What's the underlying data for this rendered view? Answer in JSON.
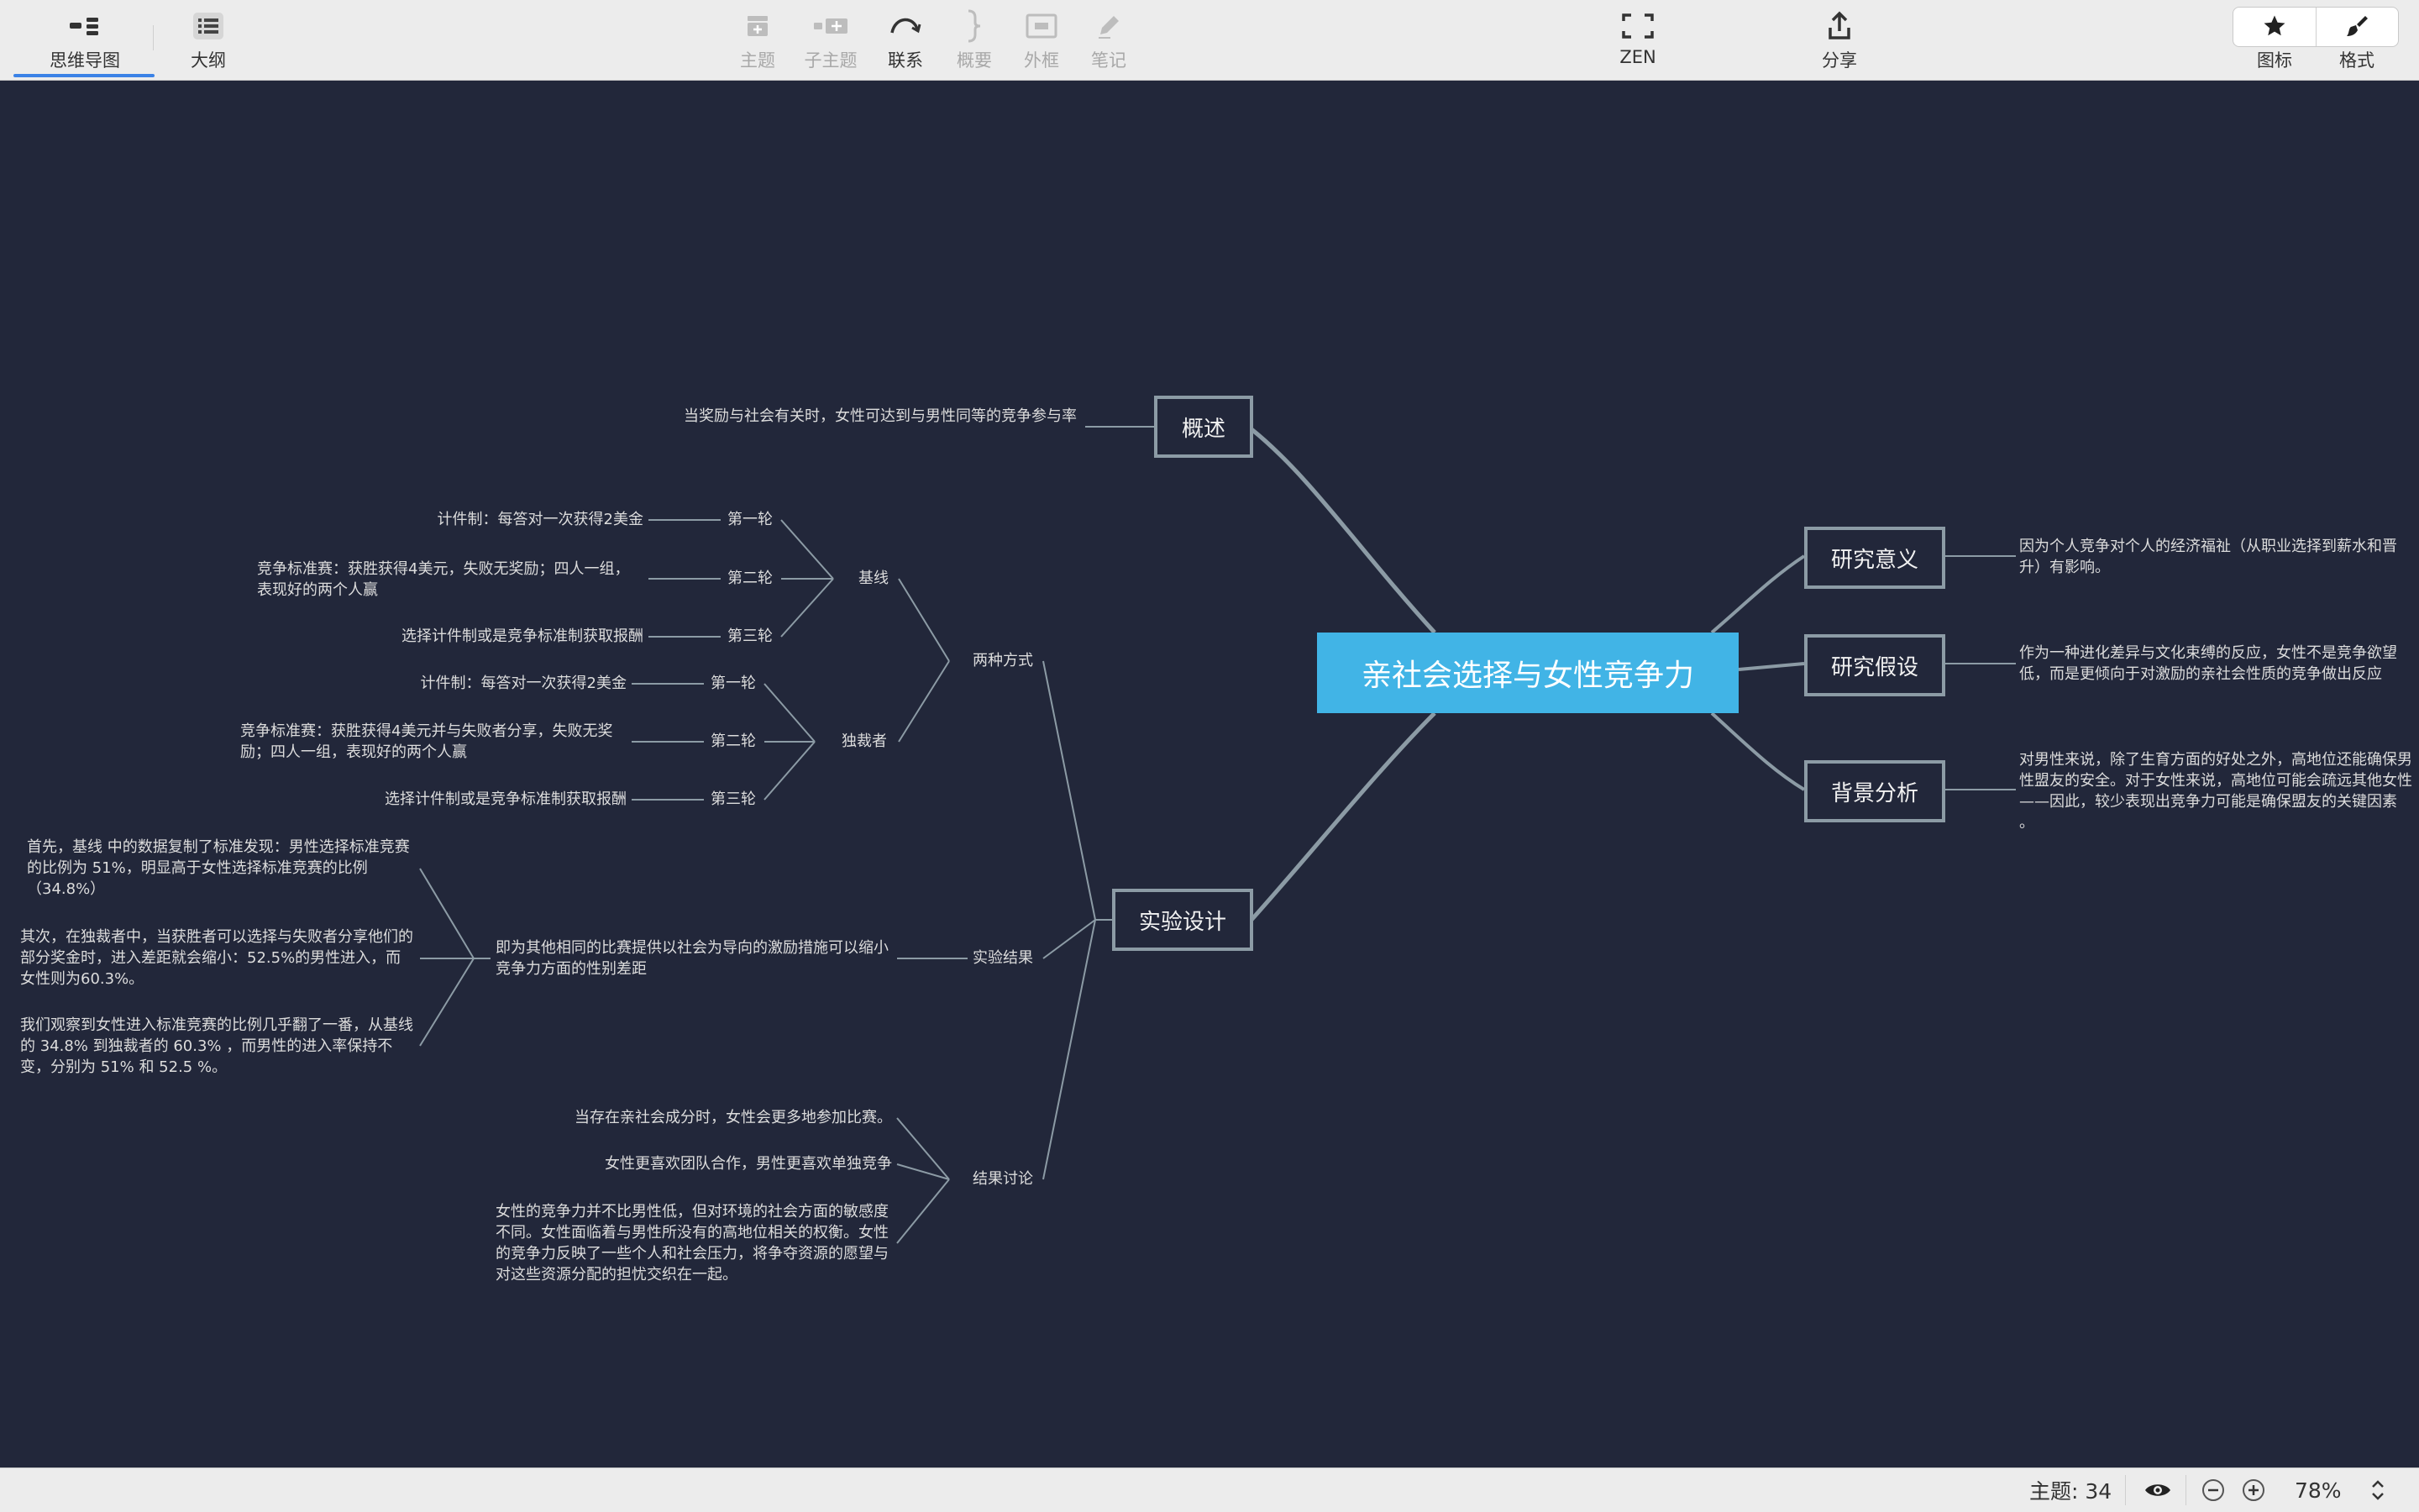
{
  "toolbar": {
    "mindmap_label": "思维导图",
    "outline_label": "大纲",
    "topic_label": "主题",
    "subtopic_label": "子主题",
    "relationship_label": "联系",
    "summary_label": "概要",
    "boundary_label": "外框",
    "notes_label": "笔记",
    "zen_label": "ZEN",
    "share_label": "分享",
    "icon_label": "图标",
    "format_label": "格式"
  },
  "map": {
    "central": "亲社会选择与女性竞争力",
    "overview": {
      "title": "概述",
      "text": "当奖励与社会有关时，女性可达到与男性同等的竞争参与率"
    },
    "significance": {
      "title": "研究意义",
      "text": "因为个人竞争对个人的经济福祉（从职业选择到薪水和晋升）有影响。"
    },
    "hypothesis": {
      "title": "研究假设",
      "text": "作为一种进化差异与文化束缚的反应，女性不是竞争欲望低，而是更倾向于对激励的亲社会性质的竞争做出反应"
    },
    "background": {
      "title": "背景分析",
      "text": "对男性来说，除了生育方面的好处之外，高地位还能确保男性盟友的安全。对于女性来说，高地位可能会疏远其他女性——因此，较少表现出竞争力可能是确保盟友的关键因素 。"
    },
    "design": {
      "title": "实验设计",
      "two_ways": {
        "label": "两种方式",
        "baseline": {
          "label": "基线",
          "rounds": [
            {
              "label": "第一轮",
              "text": "计件制：每答对一次获得2美金"
            },
            {
              "label": "第二轮",
              "text": "竞争标准赛：获胜获得4美元，失败无奖励；四人一组，表现好的两个人赢"
            },
            {
              "label": "第三轮",
              "text": "选择计件制或是竞争标准制获取报酬"
            }
          ]
        },
        "dictator": {
          "label": "独裁者",
          "rounds": [
            {
              "label": "第一轮",
              "text": "计件制：每答对一次获得2美金"
            },
            {
              "label": "第二轮",
              "text": "竞争标准赛：获胜获得4美元并与失败者分享，失败无奖励；四人一组，表现好的两个人赢"
            },
            {
              "label": "第三轮",
              "text": "选择计件制或是竞争标准制获取报酬"
            }
          ]
        }
      },
      "results": {
        "label": "实验结果",
        "summary": "即为其他相同的比赛提供以社会为导向的激励措施可以缩小竞争力方面的性别差距",
        "points": [
          "首先，基线 中的数据复制了标准发现：男性选择标准竞赛的比例为 51%，明显高于女性选择标准竞赛的比例（34.8%）",
          "其次，在独裁者中，当获胜者可以选择与失败者分享他们的部分奖金时，进入差距就会缩小：52.5%的男性进入，而女性则为60.3%。",
          "我们观察到女性进入标准竞赛的比例几乎翻了一番，从基线的 34.8% 到独裁者的 60.3% ，而男性的进入率保持不变，分别为 51% 和 52.5 %。"
        ]
      },
      "discussion": {
        "label": "结果讨论",
        "points": [
          "当存在亲社会成分时，女性会更多地参加比赛。",
          "女性更喜欢团队合作，男性更喜欢单独竞争",
          "女性的竞争力并不比男性低，但对环境的社会方面的敏感度不同。女性面临着与男性所没有的高地位相关的权衡。女性的竞争力反映了一些个人和社会压力，将争夺资源的愿望与对这些资源分配的担忧交织在一起。"
        ]
      }
    }
  },
  "statusbar": {
    "topic_count": "主题: 34",
    "zoom": "78%"
  },
  "colors": {
    "canvas_bg": "#22273a",
    "central_fill": "#41b4e6",
    "link_stroke": "#8c9ba5",
    "toolbar_bg": "#ececec",
    "active_tab": "#3b82e6"
  }
}
